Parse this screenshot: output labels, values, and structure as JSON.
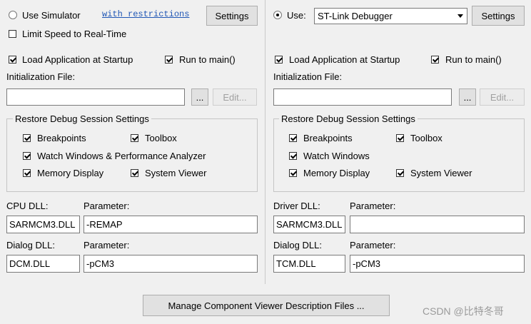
{
  "left": {
    "use_simulator_label": "Use Simulator",
    "restrictions_link": "with restrictions",
    "settings_label": "Settings",
    "limit_speed_label": "Limit Speed to Real-Time",
    "load_app_label": "Load Application at Startup",
    "run_to_main_label": "Run to main()",
    "init_file_label": "Initialization File:",
    "init_file_value": "",
    "browse_label": "...",
    "edit_label": "Edit...",
    "restore_title": "Restore Debug Session Settings",
    "breakpoints_label": "Breakpoints",
    "toolbox_label": "Toolbox",
    "watch_label": "Watch Windows & Performance Analyzer",
    "memory_label": "Memory Display",
    "system_viewer_label": "System Viewer",
    "cpu_dll_label": "CPU DLL:",
    "cpu_param_label": "Parameter:",
    "cpu_dll_value": "SARMCM3.DLL",
    "cpu_param_value": "-REMAP",
    "dialog_dll_label": "Dialog DLL:",
    "dialog_param_label": "Parameter:",
    "dialog_dll_value": "DCM.DLL",
    "dialog_param_value": "-pCM3"
  },
  "right": {
    "use_label": "Use:",
    "debugger_value": "ST-Link Debugger",
    "settings_label": "Settings",
    "load_app_label": "Load Application at Startup",
    "run_to_main_label": "Run to main()",
    "init_file_label": "Initialization File:",
    "init_file_value": "",
    "browse_label": "...",
    "edit_label": "Edit...",
    "restore_title": "Restore Debug Session Settings",
    "breakpoints_label": "Breakpoints",
    "toolbox_label": "Toolbox",
    "watch_label": "Watch Windows",
    "memory_label": "Memory Display",
    "system_viewer_label": "System Viewer",
    "driver_dll_label": "Driver DLL:",
    "driver_param_label": "Parameter:",
    "driver_dll_value": "SARMCM3.DLL",
    "driver_param_value": "",
    "dialog_dll_label": "Dialog DLL:",
    "dialog_param_label": "Parameter:",
    "dialog_dll_value": "TCM.DLL",
    "dialog_param_value": "-pCM3"
  },
  "footer": {
    "manage_button_label": "Manage Component Viewer Description Files ...",
    "watermark": "CSDN @比特冬哥"
  }
}
